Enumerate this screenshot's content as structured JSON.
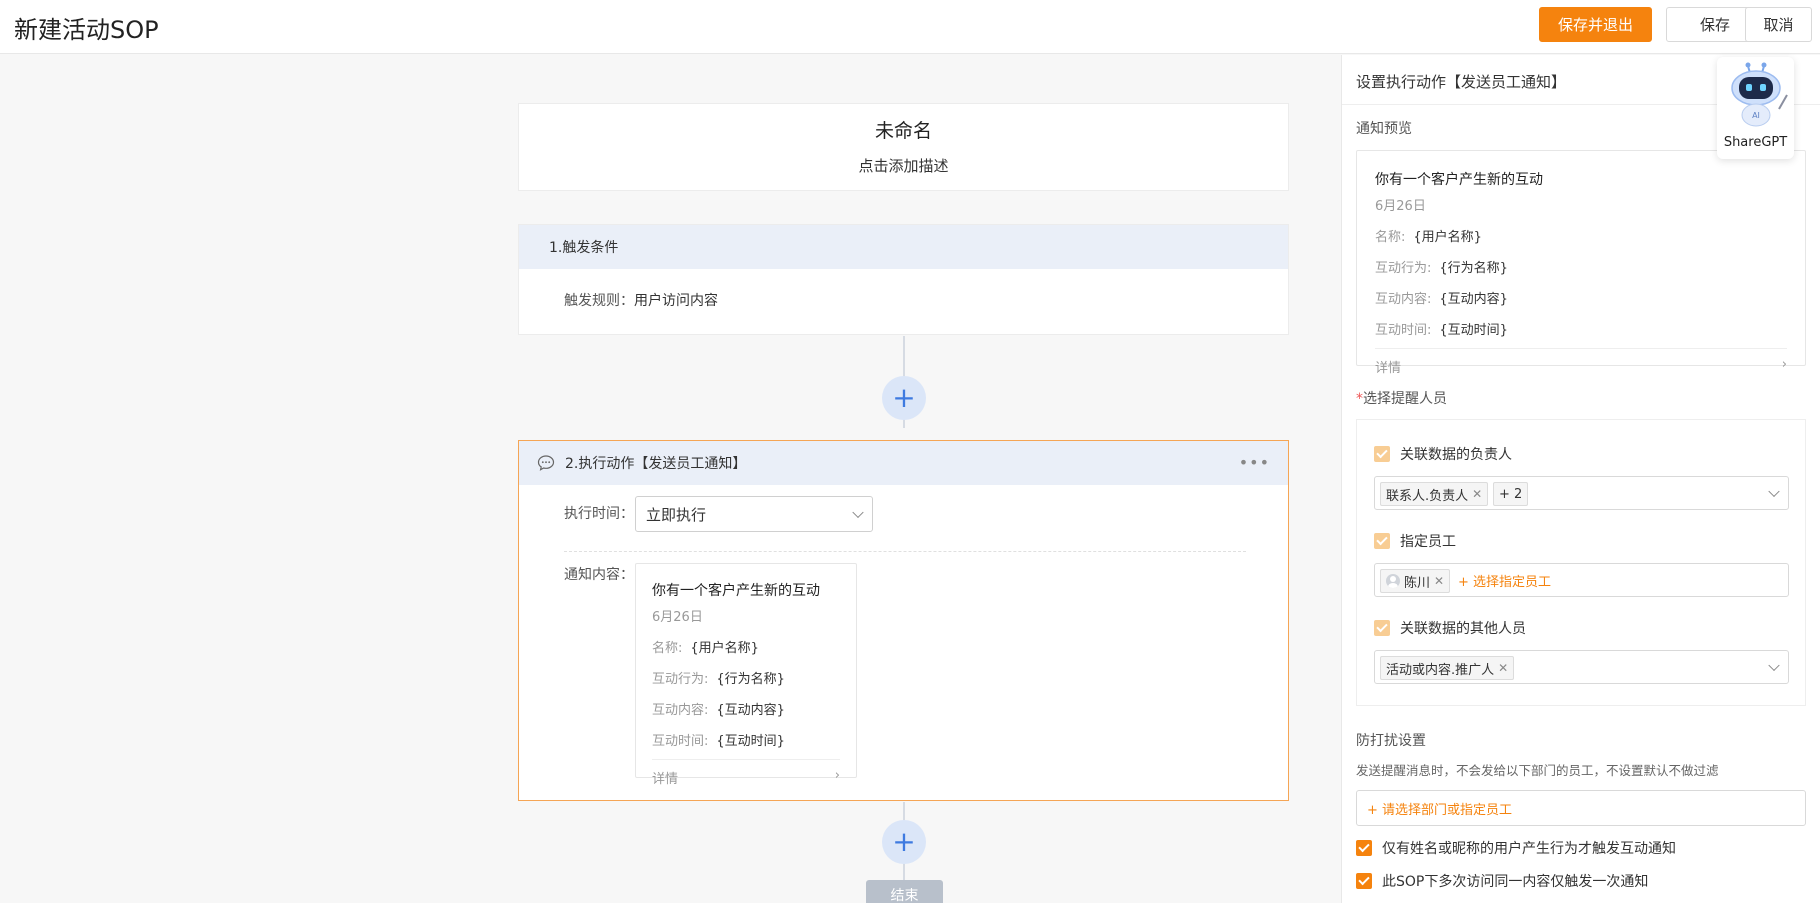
{
  "header": {
    "title": "新建活动SOP",
    "save_exit": "保存并退出",
    "save": "保存",
    "cancel": "取消"
  },
  "flow": {
    "name": "未命名",
    "description": "点击添加描述",
    "trigger": {
      "heading": "1.触发条件",
      "rule_label": "触发规则：",
      "rule_value": "用户访问内容"
    },
    "action": {
      "heading": "2.执行动作【发送员工通知】",
      "time_label": "执行时间：",
      "time_value": "立即执行",
      "content_label": "通知内容："
    },
    "end_label": "结束"
  },
  "preview": {
    "title": "你有一个客户产生新的互动",
    "date": "6月26日",
    "rows": [
      {
        "label": "名称:",
        "value": "{用户名称}"
      },
      {
        "label": "互动行为:",
        "value": "{行为名称}"
      },
      {
        "label": "互动内容:",
        "value": "{互动内容}"
      },
      {
        "label": "互动时间:",
        "value": "{互动时间}"
      }
    ],
    "detail": "详情"
  },
  "panel": {
    "title": "设置执行动作【发送员工通知】",
    "preview_label": "通知预览",
    "recipients_label": "选择提醒人员",
    "required_mark": "*",
    "options": [
      {
        "label": "关联数据的负责人",
        "tags": [
          "联系人.负责人"
        ],
        "extra": "+ 2"
      },
      {
        "label": "指定员工",
        "tags": [
          "陈川"
        ],
        "add": "+ 选择指定员工"
      },
      {
        "label": "关联数据的其他人员",
        "tags": [
          "活动或内容.推广人"
        ]
      }
    ],
    "dnd_label": "防打扰设置",
    "dnd_desc": "发送提醒消息时，不会发给以下部门的员工，不设置默认不做过滤",
    "dnd_add": "+ 请选择部门或指定员工",
    "check1": "仅有姓名或昵称的用户产生行为才触发互动通知",
    "check2": "此SOP下多次访问同一内容仅触发一次通知"
  },
  "widget": {
    "label": "ShareGPT",
    "badge": "AI"
  },
  "colors": {
    "accent": "#f5830e",
    "plus_bg": "#dbe6f8",
    "plus_fg": "#3e7ae0",
    "card_head": "#eaeff8"
  }
}
